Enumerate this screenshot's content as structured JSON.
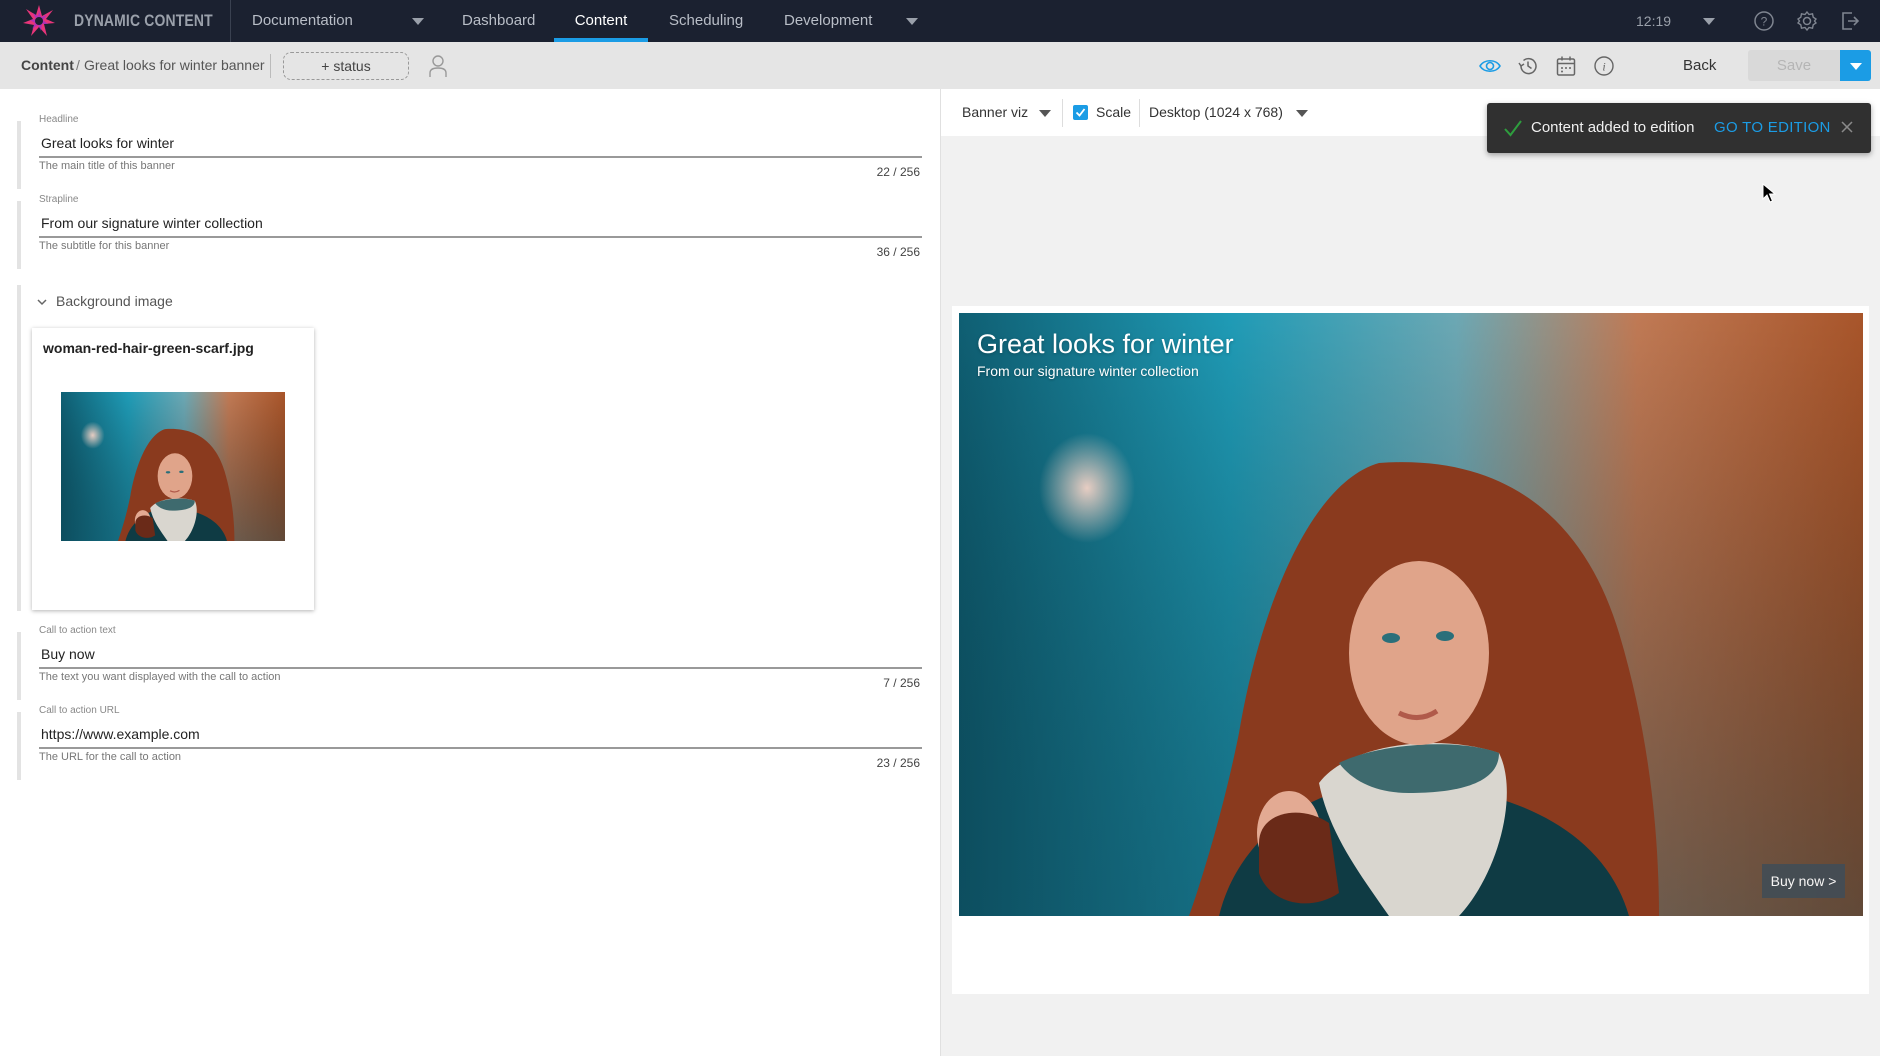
{
  "app": {
    "brand": "DYNAMIC CONTENT",
    "hub_selector": "Documentation",
    "nav": [
      {
        "label": "Dashboard",
        "active": false
      },
      {
        "label": "Content",
        "active": true
      },
      {
        "label": "Scheduling",
        "active": false
      },
      {
        "label": "Development",
        "active": false
      }
    ],
    "clock": "12:19",
    "icons": {
      "help": "help-circle-icon",
      "settings": "gear-icon",
      "logout": "logout-icon"
    },
    "accent_color": "#1b9ce5",
    "nav_bg_color": "#1b2130"
  },
  "toolbar": {
    "breadcrumb_root": "Content",
    "breadcrumb_separator": "/",
    "breadcrumb_current": "Great looks for winter banner",
    "status_button": "+ status",
    "icons": [
      "eye-icon",
      "history-icon",
      "calendar-icon",
      "info-icon"
    ],
    "back_label": "Back",
    "save_label": "Save"
  },
  "form": {
    "headline": {
      "label": "Headline",
      "value": "Great looks for winter",
      "help": "The main title of this banner",
      "count": "22 / 256"
    },
    "strapline": {
      "label": "Strapline",
      "value": "From our signature winter collection",
      "help": "The subtitle for this banner",
      "count": "36 / 256"
    },
    "background_image": {
      "title": "Background image",
      "file_name": "woman-red-hair-green-scarf.jpg"
    },
    "cta_text": {
      "label": "Call to action text",
      "value": "Buy now",
      "help": "The text you want displayed with the call to action",
      "count": "7 / 256"
    },
    "cta_url": {
      "label": "Call to action URL",
      "value": "https://www.example.com",
      "help": "The URL for the call to action",
      "count": "23 / 256"
    }
  },
  "preview": {
    "visualization": "Banner viz",
    "scale_label": "Scale",
    "scale_checked": true,
    "device": "Desktop (1024 x 768)",
    "banner_headline": "Great looks for winter",
    "banner_strapline": "From our signature winter collection",
    "banner_cta": "Buy now >"
  },
  "toast": {
    "message": "Content added to edition",
    "action": "GO TO EDITION",
    "status_color": "#2e9e3e"
  }
}
